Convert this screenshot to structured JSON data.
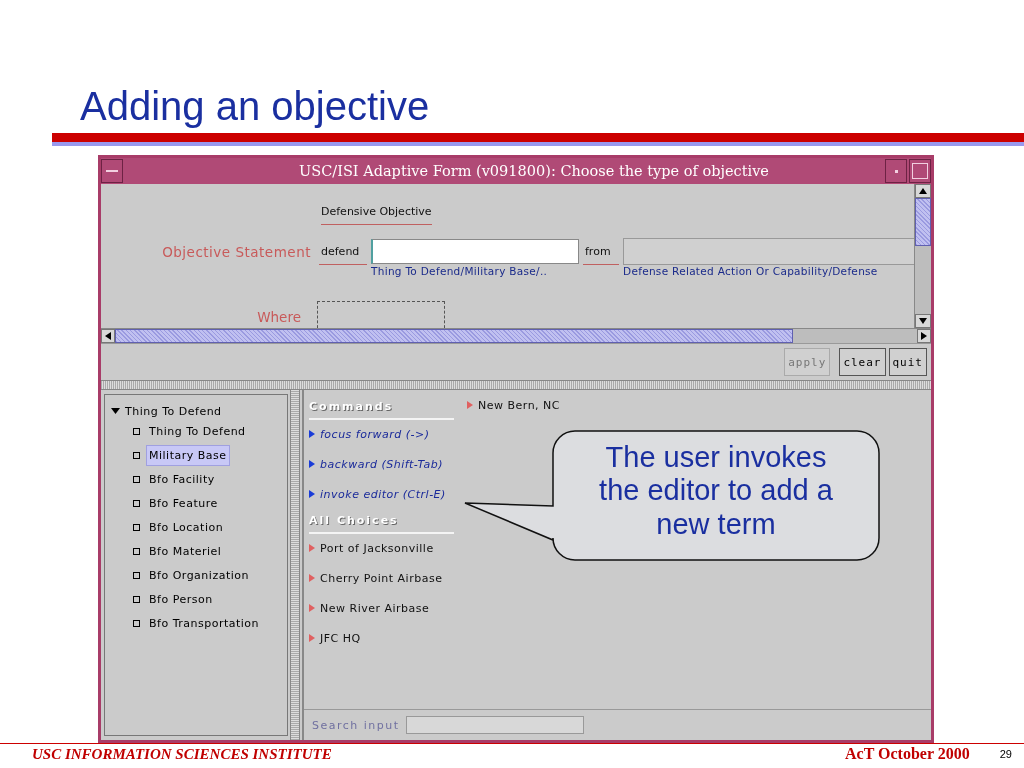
{
  "slide": {
    "title": "Adding an objective",
    "footer_left": "USC INFORMATION SCIENCES INSTITUTE",
    "footer_right": "AcT October 2000",
    "page_number": "29"
  },
  "window": {
    "title": "USC/ISI Adaptive Form (v091800): Choose the type of objective"
  },
  "form": {
    "heading": "Defensive Objective",
    "statement_label": "Objective Statement",
    "defend_label": "defend",
    "defend_hint": "Thing To Defend/Military Base/..",
    "from_label": "from",
    "from_hint": "Defense Related Action Or Capability/Defense",
    "where_label": "Where"
  },
  "buttons": [
    {
      "label": "apply",
      "disabled": true
    },
    {
      "label": "clear",
      "disabled": false
    },
    {
      "label": "quit",
      "disabled": false
    }
  ],
  "tree": {
    "label": "Thing To Defend",
    "expanded": true,
    "children": [
      {
        "label": "Thing To Defend",
        "selected": false
      },
      {
        "label": "Military Base",
        "selected": true
      },
      {
        "label": "Bfo Facility",
        "selected": false
      },
      {
        "label": "Bfo Feature",
        "selected": false
      },
      {
        "label": "Bfo Location",
        "selected": false
      },
      {
        "label": "Bfo Materiel",
        "selected": false
      },
      {
        "label": "Bfo Organization",
        "selected": false
      },
      {
        "label": "Bfo Person",
        "selected": false
      },
      {
        "label": "Bfo Transportation",
        "selected": false
      }
    ]
  },
  "commands": {
    "heading": "Commands",
    "items": [
      "focus forward (->)",
      "backward (Shift-Tab)",
      "invoke editor (Ctrl-E)"
    ]
  },
  "choices": {
    "heading": "All Choices",
    "items": [
      "Port of Jacksonville",
      "Cherry Point Airbase",
      "New River Airbase",
      "JFC HQ"
    ],
    "column_2": [
      "New Bern, NC"
    ]
  },
  "search": {
    "label": "Search input"
  },
  "callout": {
    "text": "The user invokes the editor to add a new term"
  }
}
